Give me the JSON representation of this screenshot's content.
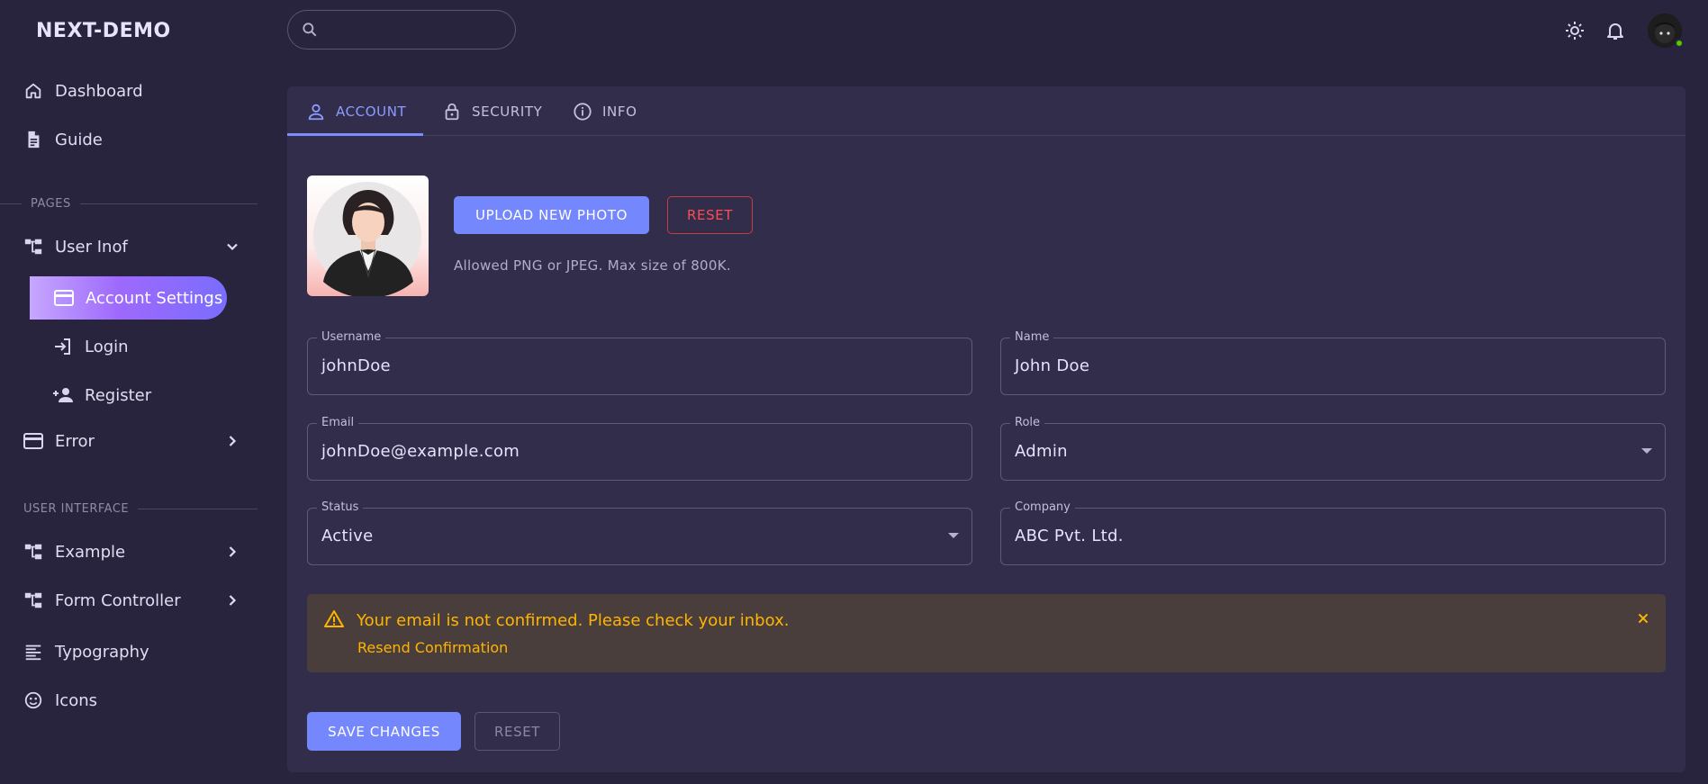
{
  "brand": "NEXT-DEMO",
  "sidebar": {
    "items_top": [
      {
        "label": "Dashboard",
        "icon": "home-icon"
      },
      {
        "label": "Guide",
        "icon": "document-icon"
      }
    ],
    "section_pages": "PAGES",
    "user_info": {
      "label": "User Inof",
      "icon": "sitemap-icon",
      "expanded": true
    },
    "user_info_children": [
      {
        "label": "Account Settings",
        "icon": "credit-card-icon",
        "active": true
      },
      {
        "label": "Login",
        "icon": "login-icon"
      },
      {
        "label": "Register",
        "icon": "account-plus-icon"
      }
    ],
    "error": {
      "label": "Error",
      "icon": "credit-card-icon"
    },
    "section_ui": "USER INTERFACE",
    "ui_items": [
      {
        "label": "Example",
        "icon": "sitemap-icon",
        "has_children": true
      },
      {
        "label": "Form Controller",
        "icon": "sitemap-icon",
        "has_children": true
      },
      {
        "label": "Typography",
        "icon": "format-letter-case-icon"
      },
      {
        "label": "Icons",
        "icon": "emoticon-icon"
      }
    ]
  },
  "topbar": {
    "search_placeholder": "",
    "icons": [
      "theme-toggle-icon",
      "bell-icon",
      "user-avatar"
    ]
  },
  "tabs": [
    {
      "label": "ACCOUNT",
      "icon": "account-outline-icon",
      "active": true
    },
    {
      "label": "SECURITY",
      "icon": "lock-open-icon",
      "active": false
    },
    {
      "label": "INFO",
      "icon": "information-icon",
      "active": false
    }
  ],
  "photo": {
    "upload_label": "UPLOAD NEW PHOTO",
    "reset_label": "RESET",
    "hint": "Allowed PNG or JPEG. Max size of 800K."
  },
  "form": {
    "username": {
      "label": "Username",
      "value": "johnDoe"
    },
    "name": {
      "label": "Name",
      "value": "John Doe"
    },
    "email": {
      "label": "Email",
      "value": "johnDoe@example.com"
    },
    "role": {
      "label": "Role",
      "value": "Admin"
    },
    "status": {
      "label": "Status",
      "value": "Active"
    },
    "company": {
      "label": "Company",
      "value": "ABC Pvt. Ltd."
    }
  },
  "alert": {
    "message": "Your email is not confirmed. Please check your inbox.",
    "link": "Resend Confirmation"
  },
  "actions": {
    "save": "SAVE CHANGES",
    "reset": "RESET"
  },
  "colors": {
    "background": "#28243d",
    "card": "#312d4b",
    "primary": "#7587fd",
    "active_gradient_start": "#c6a7fe",
    "active_gradient_end": "#7a6dfd",
    "warning": "#ffb400",
    "error": "#ff4c51"
  }
}
